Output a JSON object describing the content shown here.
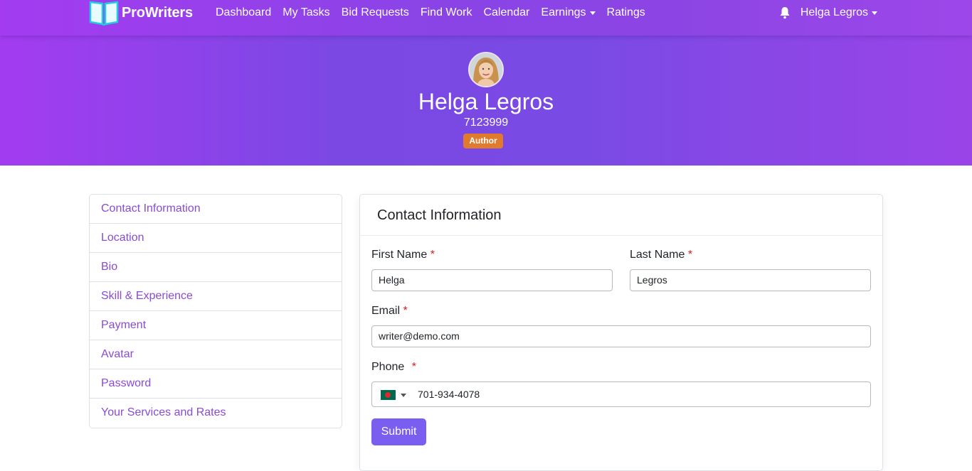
{
  "brand": {
    "name": "ProWriters",
    "icon": "open-book-icon"
  },
  "nav": {
    "links": [
      {
        "label": "Dashboard"
      },
      {
        "label": "My Tasks"
      },
      {
        "label": "Bid Requests"
      },
      {
        "label": "Find Work"
      },
      {
        "label": "Calendar"
      },
      {
        "label": "Earnings"
      },
      {
        "label": "Ratings"
      }
    ],
    "notification_icon": "bell-icon",
    "user_name": "Helga Legros"
  },
  "profile": {
    "name": "Helga Legros",
    "id": "7123999",
    "role_badge": "Author"
  },
  "sidebar": {
    "items": [
      {
        "label": "Contact Information"
      },
      {
        "label": "Location"
      },
      {
        "label": "Bio"
      },
      {
        "label": "Skill & Experience"
      },
      {
        "label": "Payment"
      },
      {
        "label": "Avatar"
      },
      {
        "label": "Password"
      },
      {
        "label": "Your Services and Rates"
      }
    ]
  },
  "form": {
    "title": "Contact Information",
    "required_mark": "*",
    "first_name": {
      "label": "First Name",
      "value": "Helga"
    },
    "last_name": {
      "label": "Last Name",
      "value": "Legros"
    },
    "email": {
      "label": "Email",
      "value": "writer@demo.com"
    },
    "phone": {
      "label": "Phone",
      "value": "701-934-4078",
      "country_flag": "bangladesh-flag-icon"
    },
    "submit_label": "Submit"
  },
  "colors": {
    "header_gradient_start": "#a33cf0",
    "header_gradient_mid": "#7b48e4",
    "link_purple": "#8a4bd3",
    "badge_orange": "#e07a2c",
    "submit_purple": "#7a5ef0",
    "required_red": "#dc1a1a"
  }
}
